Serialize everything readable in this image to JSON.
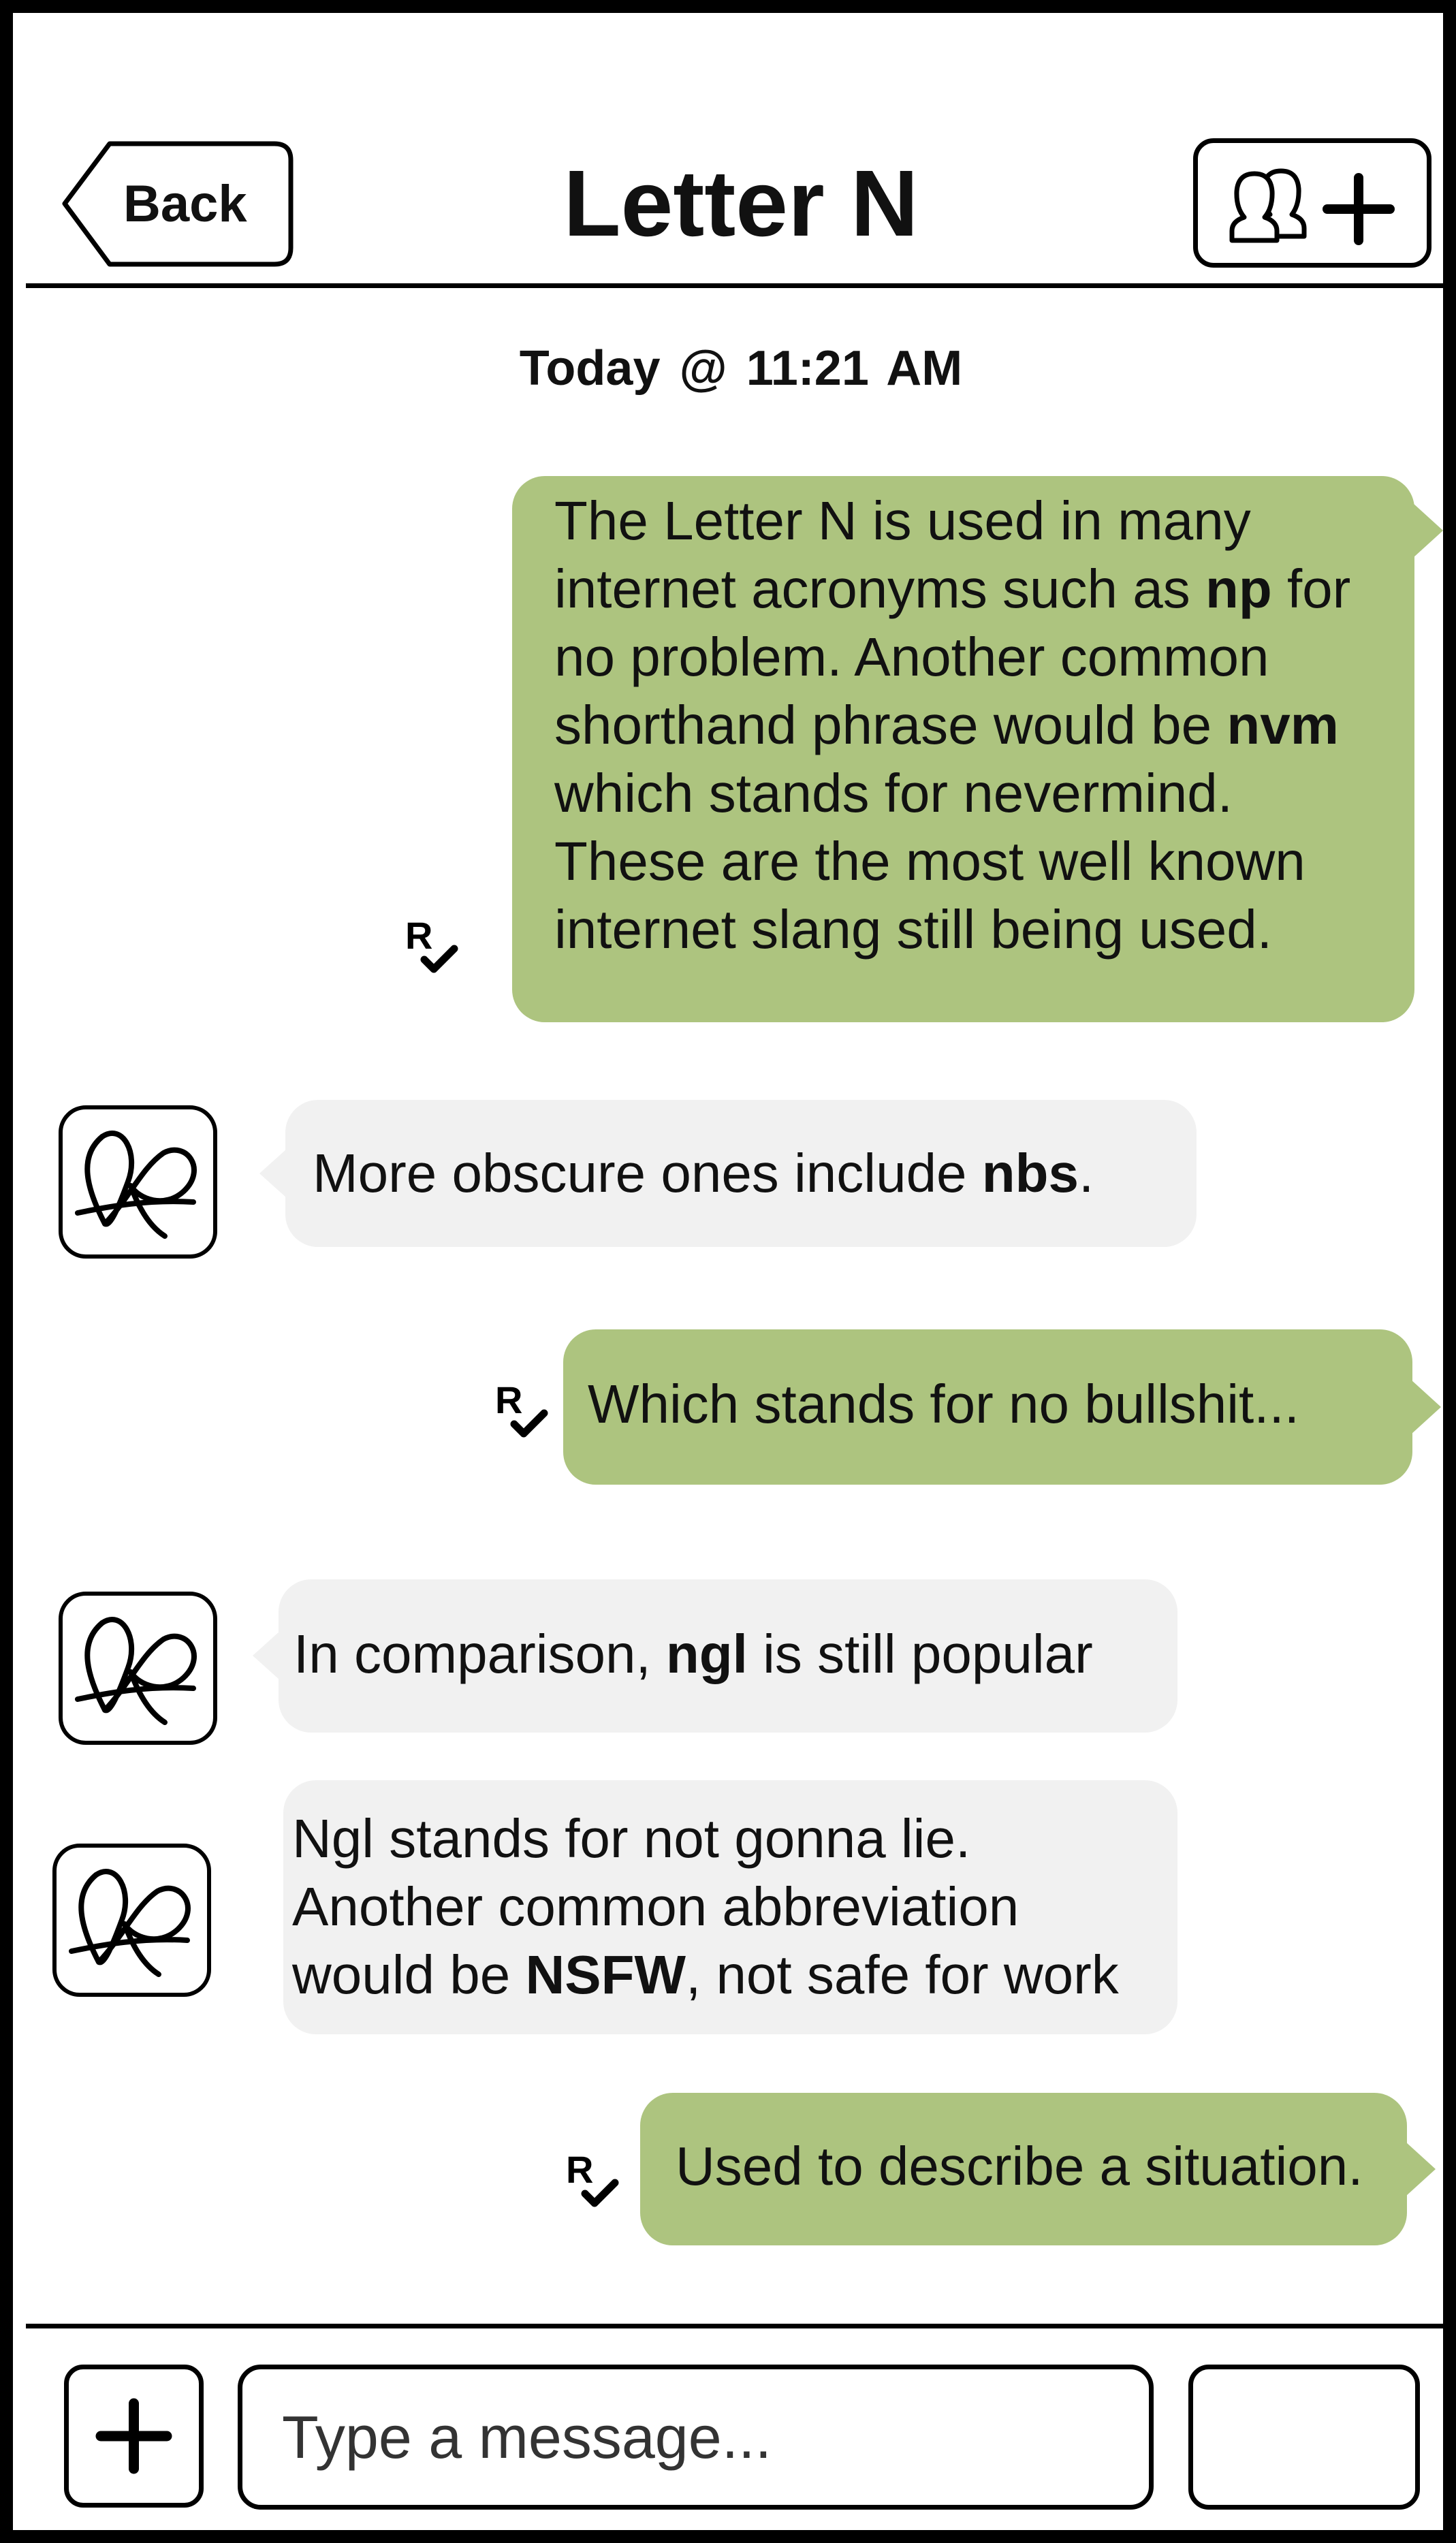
{
  "header": {
    "back_label": "Back",
    "title": "Letter N",
    "add_contact_icon": "add-contact-icon"
  },
  "timestamp": "Today @  11:21 AM",
  "read_receipt_letter": "R",
  "messages": [
    {
      "direction": "outgoing",
      "lines": [
        {
          "pre": "The Letter N is used in many",
          "bold": "",
          "post": ""
        },
        {
          "pre": "internet acronyms such as ",
          "bold": "np",
          "post": " for"
        },
        {
          "pre": "no problem. Another common",
          "bold": "",
          "post": ""
        },
        {
          "pre": "shorthand phrase would be ",
          "bold": "nvm",
          "post": ""
        },
        {
          "pre": "which stands for nevermind.",
          "bold": "",
          "post": ""
        },
        {
          "pre": "These are the most well known",
          "bold": "",
          "post": ""
        },
        {
          "pre": "internet slang still being used.",
          "bold": "",
          "post": ""
        }
      ]
    },
    {
      "direction": "incoming",
      "lines": [
        {
          "pre": "More obscure ones include ",
          "bold": "nbs",
          "post": "."
        }
      ]
    },
    {
      "direction": "outgoing",
      "lines": [
        {
          "pre": "Which stands for no bullshit...",
          "bold": "",
          "post": ""
        }
      ]
    },
    {
      "direction": "incoming",
      "lines": [
        {
          "pre": "In comparison, ",
          "bold": "ngl",
          "post": " is still popular"
        }
      ]
    },
    {
      "direction": "incoming",
      "lines": [
        {
          "pre": "Ngl stands for not gonna lie.",
          "bold": "",
          "post": ""
        },
        {
          "pre": "Another common abbreviation",
          "bold": "",
          "post": ""
        },
        {
          "pre": "would be ",
          "bold": "NSFW",
          "post": ", not safe for work"
        }
      ]
    },
    {
      "direction": "outgoing",
      "lines": [
        {
          "pre": "Used to describe a situation.",
          "bold": "",
          "post": ""
        }
      ]
    }
  ],
  "composer": {
    "placeholder": "Type a message...",
    "add_icon": "plus-icon"
  },
  "colors": {
    "outgoing_bubble": "#adc47f",
    "incoming_bubble": "#f1f1f1",
    "border": "#000000"
  }
}
